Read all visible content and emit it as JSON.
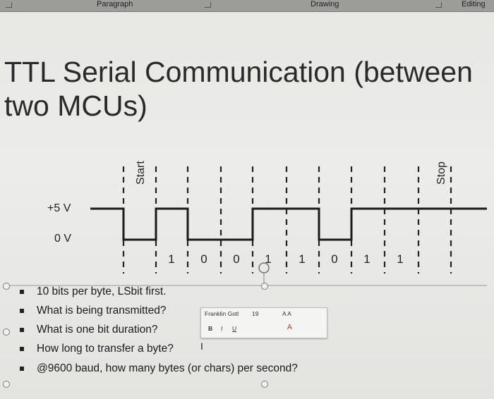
{
  "ribbon": {
    "groups": [
      "Paragraph",
      "Drawing",
      "Editing"
    ]
  },
  "slide": {
    "title_line1": "TTL Serial Communication (between",
    "title_line2": "two MCUs)",
    "diagram": {
      "label_start": "Start",
      "label_stop": "Stop",
      "level_high": "+5 V",
      "level_low": "0 V",
      "bits": [
        "1",
        "0",
        "0",
        "1",
        "1",
        "0",
        "1",
        "1"
      ]
    },
    "bullets": [
      "10 bits per byte, LSbit first.",
      "What is being transmitted?",
      "What is one bit duration?",
      "How long to transfer a byte?",
      "@9600 baud, how many bytes (or chars) per second?"
    ]
  },
  "mini_toolbar": {
    "font_name": "Franklin Gotl",
    "font_size": "19",
    "grow_shrink": "A A",
    "bold": "B",
    "italic": "I",
    "underline": "U",
    "font_color": "A"
  },
  "text_cursor": "I"
}
